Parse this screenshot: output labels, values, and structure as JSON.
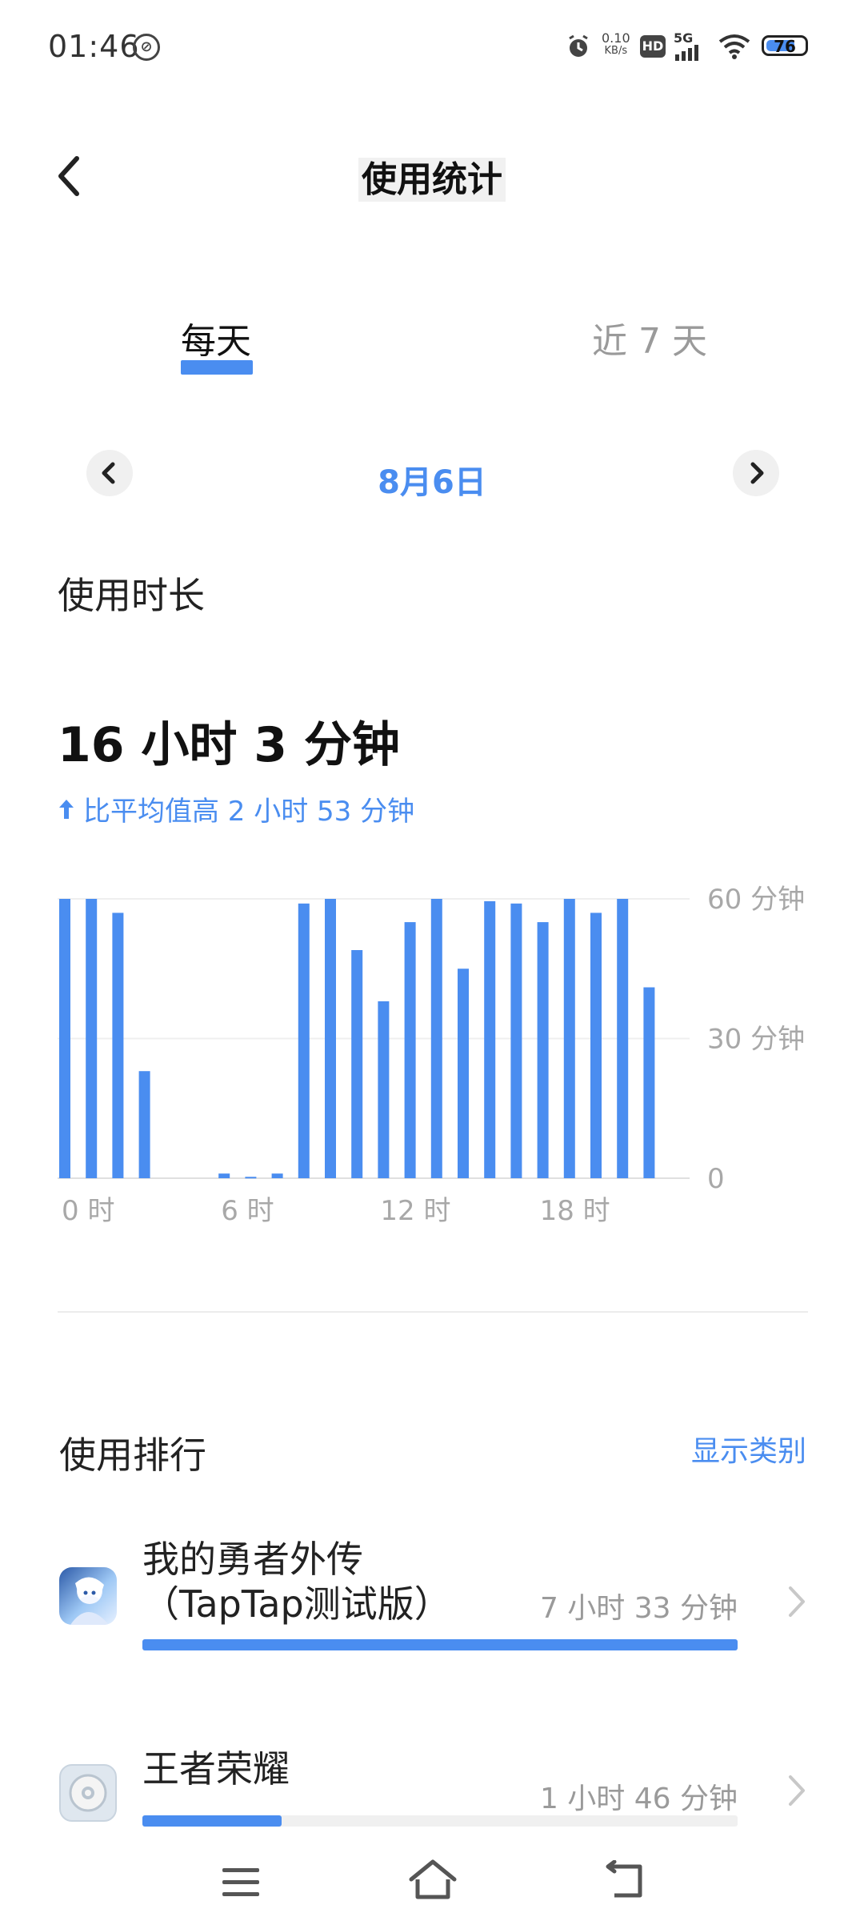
{
  "status": {
    "time": "01:46",
    "net_speed_value": "0.10",
    "net_speed_unit": "KB/s",
    "hd": "HD",
    "network": "5G",
    "battery": "76",
    "battery_level": 0.76
  },
  "header": {
    "title": "使用统计"
  },
  "tabs": [
    {
      "label": "每天",
      "active": true
    },
    {
      "label": "近 7 天",
      "active": false
    }
  ],
  "date": {
    "label": "8月6日"
  },
  "usage": {
    "label": "使用时长",
    "total": "16 小时 3 分钟",
    "compare": "比平均值高 2 小时 53 分钟"
  },
  "chart_data": {
    "type": "bar",
    "categories": [
      "0",
      "1",
      "2",
      "3",
      "4",
      "5",
      "6",
      "7",
      "8",
      "9",
      "10",
      "11",
      "12",
      "13",
      "14",
      "15",
      "16",
      "17",
      "18",
      "19",
      "20",
      "21",
      "22",
      "23"
    ],
    "values": [
      60,
      60,
      57,
      23,
      0,
      0,
      1,
      0.3,
      1,
      59,
      60,
      49,
      38,
      55,
      60,
      45,
      59.5,
      59,
      55,
      60,
      57,
      60,
      41,
      0
    ],
    "x_tick_labels": [
      "0 时",
      "6 时",
      "12 时",
      "18 时"
    ],
    "x_tick_positions": [
      0,
      6,
      12,
      18
    ],
    "y_tick_labels": [
      "60 分钟",
      "30 分钟",
      "0"
    ],
    "y_tick_values": [
      60,
      30,
      0
    ],
    "ylim": [
      0,
      60
    ],
    "color": "#4a8df0",
    "grid": true
  },
  "ranking": {
    "label": "使用排行",
    "show_category": "显示类别",
    "apps": [
      {
        "name_line1": "我的勇者外传",
        "name_line2": "（TapTap测试版）",
        "time": "7 小时 33 分钟",
        "fraction": 1.0
      },
      {
        "name_line1": "王者荣耀",
        "name_line2": "",
        "time": "1 小时 46 分钟",
        "fraction": 0.234
      }
    ]
  },
  "colors": {
    "accent": "#4a8df0",
    "muted": "#9a9a9a"
  }
}
